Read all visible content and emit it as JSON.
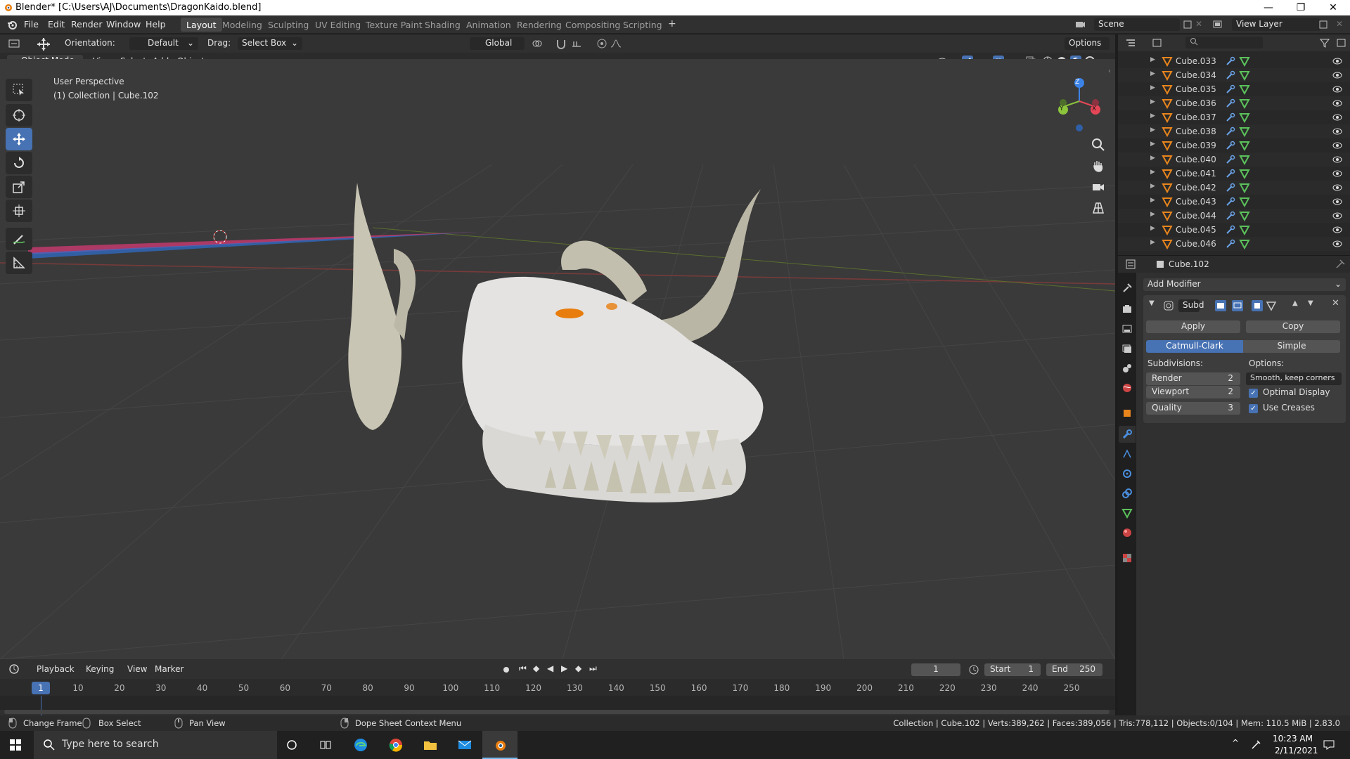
{
  "titlebar": {
    "title": "Blender* [C:\\Users\\AJ\\Documents\\DragonKaido.blend]",
    "minimize": "—",
    "maximize": "❐",
    "close": "✕"
  },
  "menu": [
    "File",
    "Edit",
    "Render",
    "Window",
    "Help"
  ],
  "workspaces": [
    "Layout",
    "Modeling",
    "Sculpting",
    "UV Editing",
    "Texture Paint",
    "Shading",
    "Animation",
    "Rendering",
    "Compositing",
    "Scripting"
  ],
  "workspace_add": "+",
  "scene": {
    "label": "Scene",
    "view_layer": "View Layer"
  },
  "tool_header": {
    "orientation_label": "Orientation:",
    "orientation_value": "Default",
    "drag_label": "Drag:",
    "drag_value": "Select Box",
    "transform": "Global",
    "options": "Options"
  },
  "viewport_header": {
    "mode": "Object Mode",
    "items": [
      "View",
      "Select",
      "Add",
      "Object"
    ]
  },
  "viewport": {
    "perspective": "User Perspective",
    "collection": "(1) Collection | Cube.102",
    "gizmo_axes": [
      "Z",
      "Y",
      "X"
    ]
  },
  "outliner": {
    "rows": [
      "Cube.033",
      "Cube.034",
      "Cube.035",
      "Cube.036",
      "Cube.037",
      "Cube.038",
      "Cube.039",
      "Cube.040",
      "Cube.041",
      "Cube.042",
      "Cube.043",
      "Cube.044",
      "Cube.045",
      "Cube.046"
    ]
  },
  "properties": {
    "object": "Cube.102",
    "add_modifier": "Add Modifier",
    "modifier_name": "Subd",
    "apply": "Apply",
    "copy": "Copy",
    "catmull": "Catmull-Clark",
    "simple": "Simple",
    "subdivisions_label": "Subdivisions:",
    "options_label": "Options:",
    "render_label": "Render",
    "render_value": "2",
    "viewport_label": "Viewport",
    "viewport_value": "2",
    "quality_label": "Quality",
    "quality_value": "3",
    "uv_smooth": "Smooth, keep corners",
    "optimal_display": "Optimal Display",
    "use_creases": "Use Creases"
  },
  "timeline": {
    "menus": [
      "Playback",
      "Keying",
      "View",
      "Marker"
    ],
    "current_frame": "1",
    "start_label": "Start",
    "start": "1",
    "end_label": "End",
    "end": "250",
    "ticks": [
      "1",
      "10",
      "20",
      "30",
      "40",
      "50",
      "60",
      "70",
      "80",
      "90",
      "100",
      "110",
      "120",
      "130",
      "140",
      "150",
      "160",
      "170",
      "180",
      "190",
      "200",
      "210",
      "220",
      "230",
      "240",
      "250"
    ]
  },
  "status": {
    "change_frame": "Change Frame",
    "box_select": "Box Select",
    "pan_view": "Pan View",
    "context_menu": "Dope Sheet Context Menu",
    "stats": "Collection | Cube.102 | Verts:389,262 | Faces:389,056 | Tris:778,112 | Objects:0/104 | Mem: 110.5 MiB | 2.83.0"
  },
  "taskbar": {
    "search_placeholder": "Type here to search",
    "time": "10:23 AM",
    "date": "2/11/2021"
  },
  "colors": {
    "accent": "#4772b3",
    "panel": "#303030",
    "viewport": "#3a3a3a",
    "orange": "#e87d0d",
    "green_axis": "#8cc43c",
    "red_axis": "#e54656",
    "blue_axis": "#3b82e6"
  }
}
